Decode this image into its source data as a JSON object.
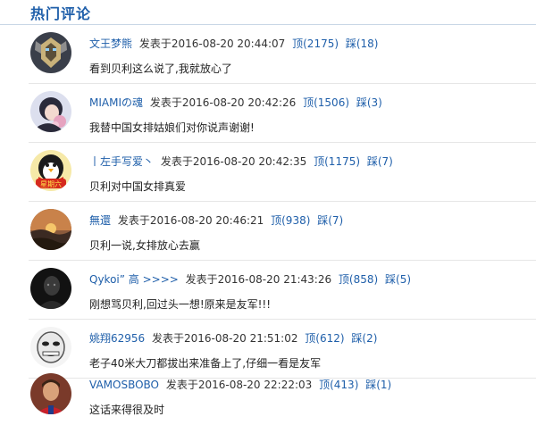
{
  "section": {
    "title": "热门评论"
  },
  "comments": [
    {
      "username": "文王梦熊",
      "posted": "发表于2016-08-20 20:44:07",
      "up": "顶(2175)",
      "down": "踩(18)",
      "content": "看到贝利这么说了,我就放心了",
      "avatar": "robot-avatar-icon"
    },
    {
      "username": "MIAMIの魂",
      "posted": "发表于2016-08-20 20:42:26",
      "up": "顶(1506)",
      "down": "踩(3)",
      "content": "我替中国女排姑娘们对你说声谢谢!",
      "avatar": "anime-girl-avatar-icon"
    },
    {
      "username": "丨左手写爱丶",
      "posted": "发表于2016-08-20 20:42:35",
      "up": "顶(1175)",
      "down": "踩(7)",
      "content": "贝利对中国女排真爱",
      "avatar": "penguin-avatar-icon",
      "avatar_text": "星期六"
    },
    {
      "username": "無還",
      "posted": "发表于2016-08-20 20:46:21",
      "up": "顶(938)",
      "down": "踩(7)",
      "content": "贝利一说,女排放心去赢",
      "avatar": "sunset-avatar-icon"
    },
    {
      "username": "Qykoi” 高 >>>>",
      "posted": "发表于2016-08-20 21:43:26",
      "up": "顶(858)",
      "down": "踩(5)",
      "content": "刚想骂贝利,回过头一想!原来是友军!!!",
      "avatar": "dark-portrait-avatar-icon"
    },
    {
      "username": "姚翔62956",
      "posted": "发表于2016-08-20 21:51:02",
      "up": "顶(612)",
      "down": "踩(2)",
      "content": "老子40米大刀都拔出来准备上了,仔细一看是友军",
      "avatar": "meme-face-avatar-icon"
    },
    {
      "username": "VAMOSBOBO",
      "posted": "发表于2016-08-20 22:22:03",
      "up": "顶(413)",
      "down": "踩(1)",
      "content": "这话来得很及时",
      "avatar": "footballer-avatar-icon"
    }
  ],
  "colors": {
    "accent": "#1f5faa",
    "divider": "#e6e6e6",
    "text": "#222222"
  }
}
